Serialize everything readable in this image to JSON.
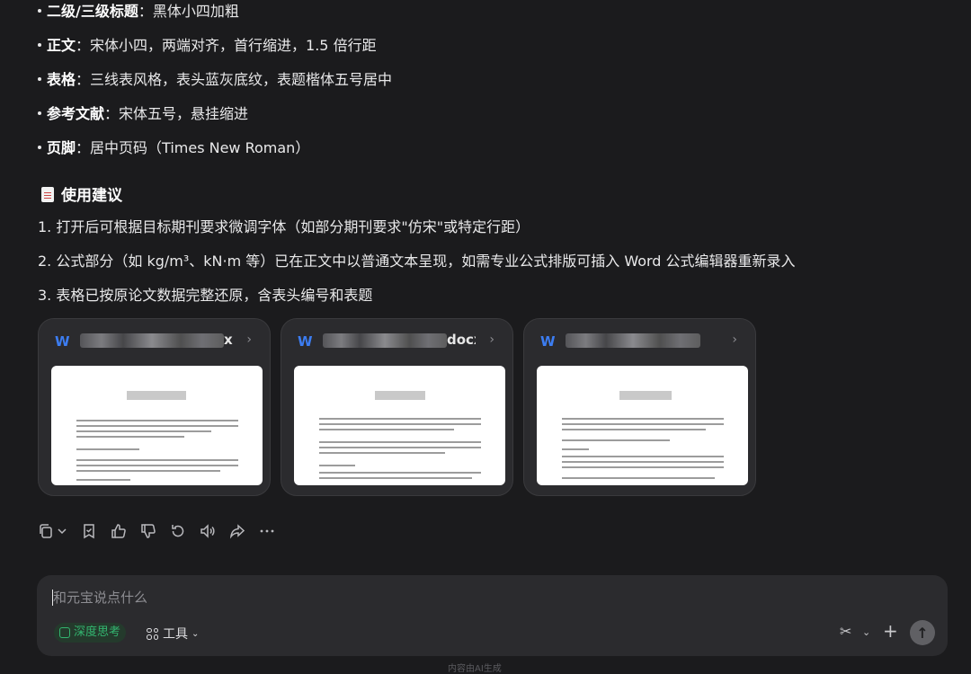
{
  "format_items": [
    {
      "key": "二级/三级标题",
      "sep": "：",
      "value": "黑体小四加粗"
    },
    {
      "key": "正文",
      "sep": "：",
      "value": "宋体小四，两端对齐，首行缩进，1.5 倍行距"
    },
    {
      "key": "表格",
      "sep": "：",
      "value": "三线表风格，表头蓝灰底纹，表题楷体五号居中"
    },
    {
      "key": "参考文献",
      "sep": "：",
      "value": "宋体五号，悬挂缩进"
    },
    {
      "key": "页脚",
      "sep": "：",
      "value": "居中页码（Times New Roman）"
    }
  ],
  "suggestions": {
    "title": "使用建议",
    "items": [
      "1. 打开后可根据目标期刊要求微调字体（如部分期刊要求\"仿宋\"或特定行距）",
      "2. 公式部分（如 kg/m³、kN·m 等）已在正文中以普通文本呈现，如需专业公式排版可插入 Word 公式编辑器重新录入",
      "3. 表格已按原论文数据完整还原，含表头编号和表题"
    ]
  },
  "files": [
    {
      "icon": "W",
      "name_visible": "x"
    },
    {
      "icon": "W",
      "name_visible": "docx"
    },
    {
      "icon": "W",
      "name_visible": ""
    }
  ],
  "composer": {
    "placeholder": "和元宝说点什么",
    "deep_think_label": "深度思考",
    "tools_label": "工具"
  },
  "footer_text": "内容由AI生成"
}
